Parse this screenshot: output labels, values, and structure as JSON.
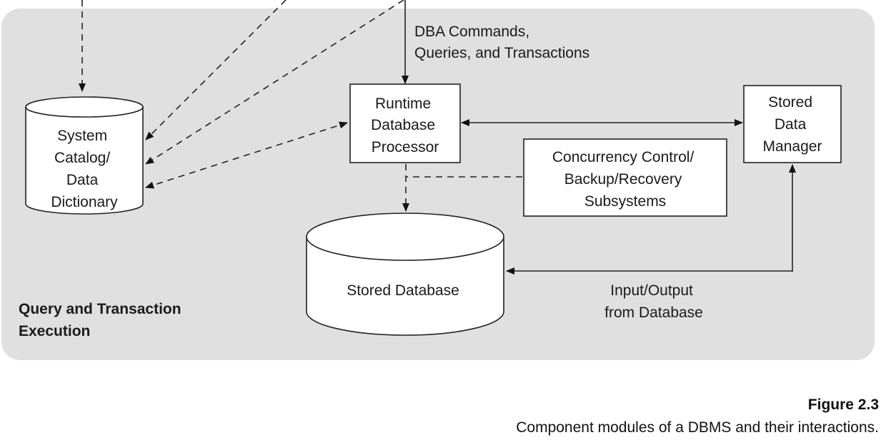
{
  "panel": {
    "title_lines": [
      "Query and Transaction",
      "Execution"
    ],
    "background": "#e0e0e0"
  },
  "nodes": {
    "system_catalog": {
      "lines": [
        "System",
        "Catalog/",
        "Data",
        "Dictionary"
      ],
      "shape": "cylinder"
    },
    "runtime_processor": {
      "lines": [
        "Runtime",
        "Database",
        "Processor"
      ],
      "shape": "box"
    },
    "stored_data_manager": {
      "lines": [
        "Stored",
        "Data",
        "Manager"
      ],
      "shape": "box"
    },
    "concurrency": {
      "lines": [
        "Concurrency Control/",
        "Backup/Recovery",
        "Subsystems"
      ],
      "shape": "box"
    },
    "stored_database": {
      "lines": [
        "Stored Database"
      ],
      "shape": "cylinder"
    }
  },
  "edge_labels": {
    "dba_commands": [
      "DBA Commands,",
      "Queries, and Transactions"
    ],
    "io": [
      "Input/Output",
      "from Database"
    ]
  },
  "caption": {
    "figure_number": "Figure 2.3",
    "text": "Component modules of a DBMS and their interactions."
  }
}
